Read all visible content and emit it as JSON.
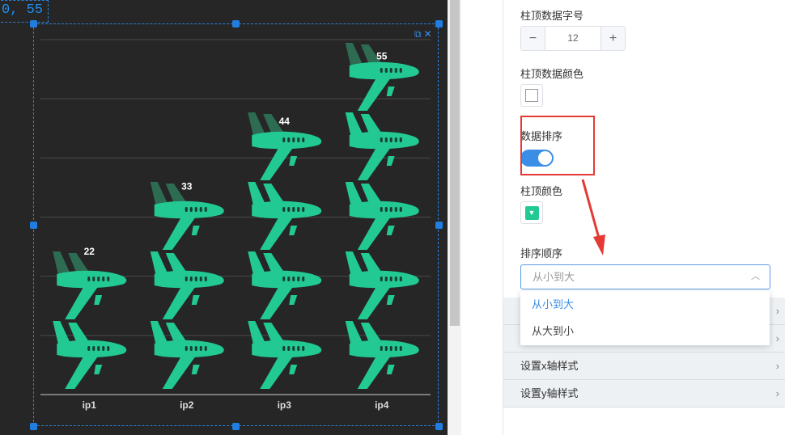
{
  "canvas": {
    "coord_readout": "0, 55",
    "chart_tools": {
      "restore_icon": "restore-icon",
      "close_icon": "close-icon"
    }
  },
  "chart_data": {
    "type": "bar",
    "categories": [
      "ip1",
      "ip2",
      "ip3",
      "ip4"
    ],
    "values": [
      22,
      33,
      44,
      55
    ],
    "ylim": [
      0,
      60
    ],
    "grid": true,
    "bar_color": "#22c993",
    "bar_top_color": "#2d6b52",
    "data_label_color": "#ffffff",
    "icon": "airplane-icon"
  },
  "panel": {
    "font_size_label": "柱顶数据字号",
    "font_size_value": "12",
    "minus": "−",
    "plus": "+",
    "label_color_label": "柱顶数据颜色",
    "sort_label": "数据排序",
    "sort_enabled": true,
    "top_color_label": "柱顶颜色",
    "top_color": "#22c993",
    "order_label": "排序顺序",
    "order_value": "从小到大",
    "order_options": [
      "从小到大",
      "从大到小"
    ],
    "sections": [
      "设置x轴样式",
      "设置y轴样式"
    ],
    "toggle_color": "#3a8ee6",
    "highlight_color": "#e53935"
  }
}
